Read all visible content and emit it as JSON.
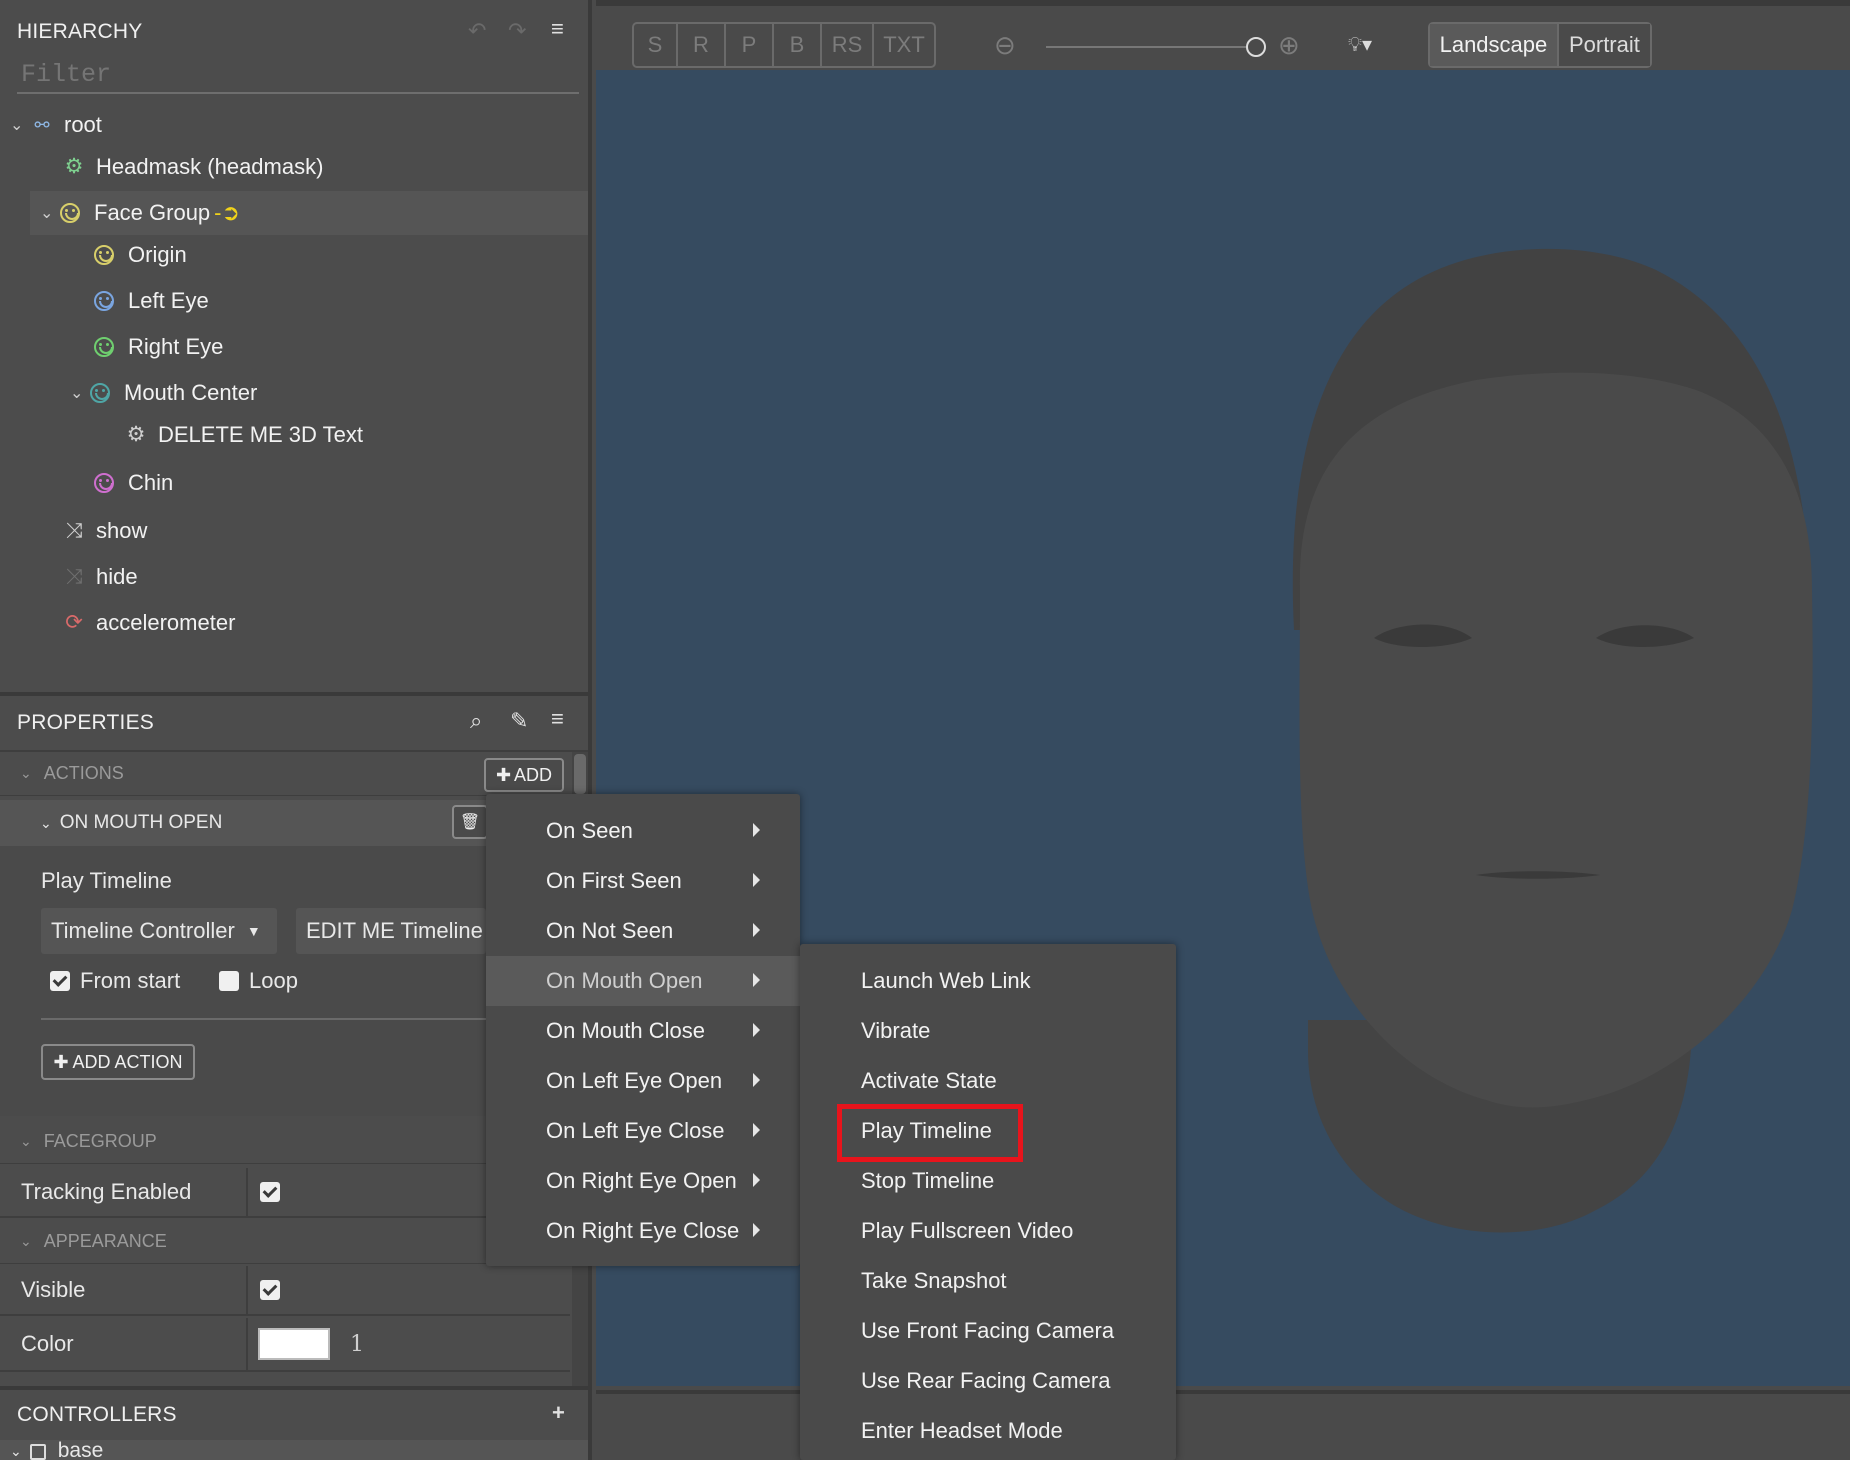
{
  "hierarchy": {
    "title": "HIERARCHY",
    "filter_placeholder": "Filter",
    "items": [
      {
        "label": "root"
      },
      {
        "label": "Headmask (headmask)"
      },
      {
        "label": "Face Group"
      },
      {
        "label": "Origin"
      },
      {
        "label": "Left Eye"
      },
      {
        "label": "Right Eye"
      },
      {
        "label": "Mouth Center"
      },
      {
        "label": "DELETE ME 3D Text"
      },
      {
        "label": "Chin"
      },
      {
        "label": "show"
      },
      {
        "label": "hide"
      },
      {
        "label": "accelerometer"
      }
    ]
  },
  "properties": {
    "title": "PROPERTIES",
    "actions_section": "ACTIONS",
    "add_label": "ADD",
    "trigger_title": "ON MOUTH OPEN",
    "action_name": "Play Timeline",
    "controller_select": "Timeline Controller",
    "timeline_select": "EDIT ME Timeline",
    "from_start": "From start",
    "loop": "Loop",
    "add_action": "ADD ACTION",
    "facegroup_section": "FACEGROUP",
    "tracking_enabled": "Tracking Enabled",
    "appearance_section": "APPEARANCE",
    "visible": "Visible",
    "color": "Color",
    "color_value": "#ffffff",
    "opacity": "1"
  },
  "controllers": {
    "title": "CONTROLLERS",
    "first_item": "base"
  },
  "toolbar": {
    "modes": [
      "S",
      "R",
      "P",
      "B",
      "RS",
      "TXT"
    ],
    "zoom_level": 1.0,
    "orientation": [
      "Landscape",
      "Portrait"
    ],
    "active_orientation": "Landscape"
  },
  "trigger_menu": {
    "items": [
      "On Seen",
      "On First Seen",
      "On Not Seen",
      "On Mouth Open",
      "On Mouth Close",
      "On Left Eye Open",
      "On Left Eye Close",
      "On Right Eye Open",
      "On Right Eye Close"
    ],
    "highlighted": "On Mouth Open"
  },
  "action_menu": {
    "items": [
      "Launch Web Link",
      "Vibrate",
      "Activate State",
      "Play Timeline",
      "Stop Timeline",
      "Play Fullscreen Video",
      "Take Snapshot",
      "Use Front Facing Camera",
      "Use Rear Facing Camera",
      "Enter Headset Mode"
    ],
    "boxed": "Play Timeline"
  },
  "colors": {
    "viewport_bg": "#364b60",
    "face": "#4a4a4a",
    "highlight_box": "#e8141c",
    "origin_icon": "#d8cf6a",
    "left_eye_icon": "#7aa5e0",
    "right_eye_icon": "#6fcf6f",
    "mouth_icon": "#4fa6a6",
    "chin_icon": "#cf6fcf"
  }
}
